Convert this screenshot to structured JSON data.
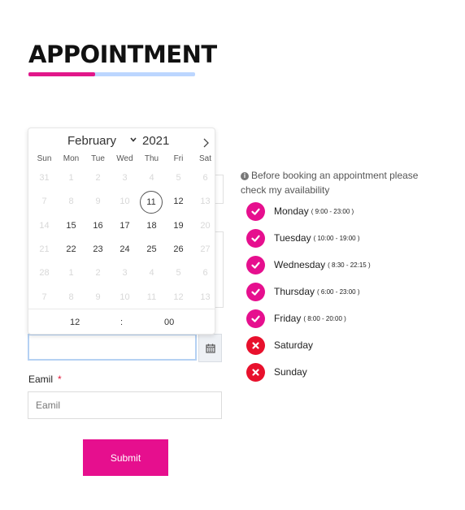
{
  "page": {
    "title": "APPOINTMENT"
  },
  "colors": {
    "accent": "#e60f8e",
    "closed": "#e8102c",
    "underline": "#bcd6ff"
  },
  "calendar": {
    "month": "February",
    "year": "2021",
    "next_icon": "chevron-right-icon",
    "weekdays": [
      "Sun",
      "Mon",
      "Tue",
      "Wed",
      "Thu",
      "Fri",
      "Sat"
    ],
    "weeks": [
      [
        {
          "d": "31",
          "m": true
        },
        {
          "d": "1",
          "m": true
        },
        {
          "d": "2",
          "m": true
        },
        {
          "d": "3",
          "m": true
        },
        {
          "d": "4",
          "m": true
        },
        {
          "d": "5",
          "m": true
        },
        {
          "d": "6",
          "m": true
        }
      ],
      [
        {
          "d": "7",
          "m": true
        },
        {
          "d": "8",
          "m": true
        },
        {
          "d": "9",
          "m": true
        },
        {
          "d": "10",
          "m": true
        },
        {
          "d": "11",
          "m": false,
          "today": true
        },
        {
          "d": "12",
          "m": false
        },
        {
          "d": "13",
          "m": true
        }
      ],
      [
        {
          "d": "14",
          "m": true
        },
        {
          "d": "15",
          "m": false
        },
        {
          "d": "16",
          "m": false
        },
        {
          "d": "17",
          "m": false
        },
        {
          "d": "18",
          "m": false
        },
        {
          "d": "19",
          "m": false
        },
        {
          "d": "20",
          "m": true
        }
      ],
      [
        {
          "d": "21",
          "m": true
        },
        {
          "d": "22",
          "m": false
        },
        {
          "d": "23",
          "m": false
        },
        {
          "d": "24",
          "m": false
        },
        {
          "d": "25",
          "m": false
        },
        {
          "d": "26",
          "m": false
        },
        {
          "d": "27",
          "m": true
        }
      ],
      [
        {
          "d": "28",
          "m": true
        },
        {
          "d": "1",
          "m": true
        },
        {
          "d": "2",
          "m": true
        },
        {
          "d": "3",
          "m": true
        },
        {
          "d": "4",
          "m": true
        },
        {
          "d": "5",
          "m": true
        },
        {
          "d": "6",
          "m": true
        }
      ],
      [
        {
          "d": "7",
          "m": true
        },
        {
          "d": "8",
          "m": true
        },
        {
          "d": "9",
          "m": true
        },
        {
          "d": "10",
          "m": true
        },
        {
          "d": "11",
          "m": true
        },
        {
          "d": "12",
          "m": true
        },
        {
          "d": "13",
          "m": true
        }
      ]
    ],
    "time": {
      "hour": "12",
      "separator": ":",
      "minute": "00"
    }
  },
  "form": {
    "date_button_icon": "calendar-icon",
    "email_label": "Eamil",
    "required_mark": "*",
    "email_placeholder": "Eamil",
    "submit_label": "Submit"
  },
  "availability": {
    "note_icon": "info-icon",
    "note": "Before booking an appointment please check my availability",
    "days": [
      {
        "name": "Monday",
        "hours": "( 9:00 - 23:00 )",
        "open": true
      },
      {
        "name": "Tuesday",
        "hours": "( 10:00 - 19:00 )",
        "open": true
      },
      {
        "name": "Wednesday",
        "hours": "( 8:30 - 22:15 )",
        "open": true
      },
      {
        "name": "Thursday",
        "hours": "( 6:00 - 23:00 )",
        "open": true
      },
      {
        "name": "Friday",
        "hours": "( 8:00 - 20:00 )",
        "open": true
      },
      {
        "name": "Saturday",
        "hours": "",
        "open": false
      },
      {
        "name": "Sunday",
        "hours": "",
        "open": false
      }
    ]
  }
}
